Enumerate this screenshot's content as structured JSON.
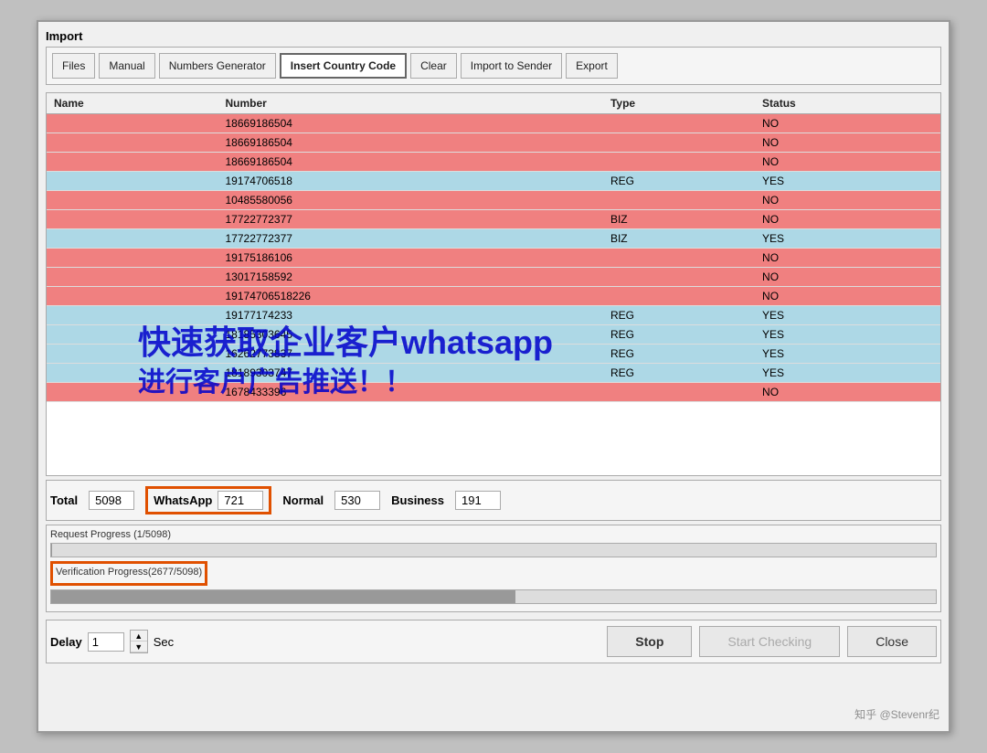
{
  "window": {
    "title": "Import"
  },
  "toolbar": {
    "buttons": [
      {
        "id": "files",
        "label": "Files",
        "active": false
      },
      {
        "id": "manual",
        "label": "Manual",
        "active": false
      },
      {
        "id": "numbers-gen",
        "label": "Numbers Generator",
        "active": false
      },
      {
        "id": "insert-country",
        "label": "Insert Country Code",
        "active": true
      },
      {
        "id": "clear",
        "label": "Clear",
        "active": false
      },
      {
        "id": "import-sender",
        "label": "Import to Sender",
        "active": false
      },
      {
        "id": "export",
        "label": "Export",
        "active": false
      }
    ]
  },
  "table": {
    "headers": [
      "Name",
      "Number",
      "Type",
      "Status"
    ],
    "rows": [
      {
        "name": "",
        "number": "18669186504",
        "type": "",
        "status": "NO",
        "color": "red"
      },
      {
        "name": "",
        "number": "18669186504",
        "type": "",
        "status": "NO",
        "color": "red"
      },
      {
        "name": "",
        "number": "18669186504",
        "type": "",
        "status": "NO",
        "color": "red"
      },
      {
        "name": "",
        "number": "19174706518",
        "type": "REG",
        "status": "YES",
        "color": "blue"
      },
      {
        "name": "",
        "number": "10485580056",
        "type": "",
        "status": "NO",
        "color": "red"
      },
      {
        "name": "",
        "number": "17722772377",
        "type": "BIZ",
        "status": "NO",
        "color": "red"
      },
      {
        "name": "",
        "number": "17722772377",
        "type": "BIZ",
        "status": "YES",
        "color": "blue"
      },
      {
        "name": "",
        "number": "19175186106",
        "type": "",
        "status": "NO",
        "color": "red"
      },
      {
        "name": "",
        "number": "13017158592",
        "type": "",
        "status": "NO",
        "color": "red"
      },
      {
        "name": "",
        "number": "19174706518226",
        "type": "",
        "status": "NO",
        "color": "red"
      },
      {
        "name": "",
        "number": "19177174233",
        "type": "REG",
        "status": "YES",
        "color": "blue"
      },
      {
        "name": "",
        "number": "18185303645",
        "type": "REG",
        "status": "YES",
        "color": "blue"
      },
      {
        "name": "",
        "number": "16262773837",
        "type": "REG",
        "status": "YES",
        "color": "blue"
      },
      {
        "name": "",
        "number": "18189303747",
        "type": "REG",
        "status": "YES",
        "color": "blue"
      },
      {
        "name": "",
        "number": "1678433396",
        "type": "",
        "status": "NO",
        "color": "red"
      }
    ]
  },
  "stats": {
    "total_label": "Total",
    "total_value": "5098",
    "whatsapp_label": "WhatsApp",
    "whatsapp_value": "721",
    "normal_label": "Normal",
    "normal_value": "530",
    "business_label": "Business",
    "business_value": "191"
  },
  "progress": {
    "request_label": "Request Progress (1/5098)",
    "request_percent": 0.02,
    "verification_label": "Verification Progress(2677/5098)",
    "verification_percent": 52.5
  },
  "delay": {
    "label": "Delay",
    "value": "1",
    "unit": "Sec"
  },
  "buttons": {
    "stop": "Stop",
    "start_checking": "Start Checking",
    "close": "Close"
  },
  "watermark": {
    "line1": "快速获取企业客户whatsapp",
    "line2": "进行客户广告推送！！"
  },
  "zhihu": "知乎 @Stevenr纪"
}
